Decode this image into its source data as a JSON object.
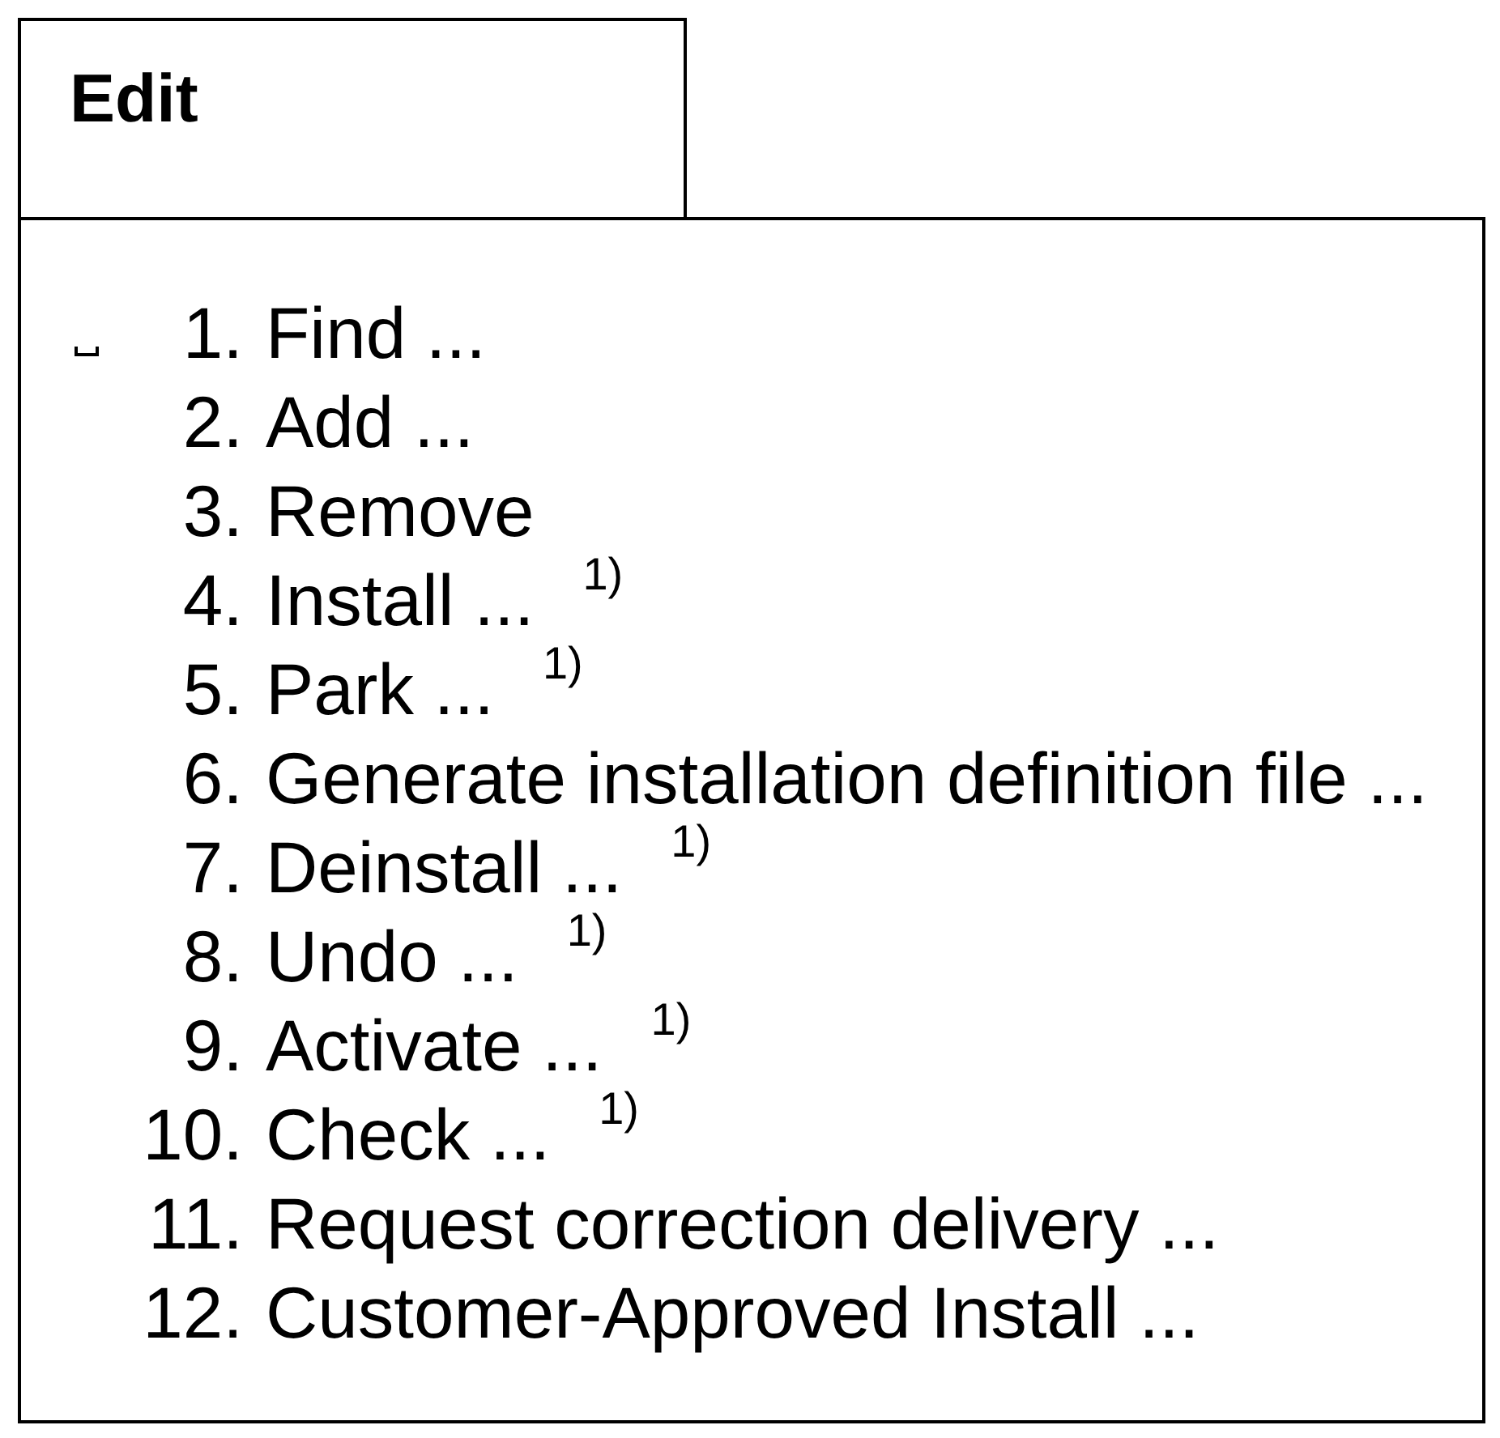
{
  "menu": {
    "title": "Edit",
    "items": [
      {
        "number": "1.",
        "label": "Find ...",
        "selected": true
      },
      {
        "number": "2.",
        "label": "Add ...",
        "selected": false
      },
      {
        "number": "3.",
        "label": "Remove",
        "selected": false
      },
      {
        "number": "4.",
        "label": "Install ...",
        "footnote": "1)",
        "selected": false
      },
      {
        "number": "5.",
        "label": "Park ...",
        "footnote": "1)",
        "selected": false
      },
      {
        "number": "6.",
        "label": "Generate installation definition file ...",
        "selected": false
      },
      {
        "number": "7.",
        "label": "Deinstall ...",
        "footnote": "1)",
        "selected": false
      },
      {
        "number": "8.",
        "label": "Undo ...",
        "footnote": "1)",
        "selected": false
      },
      {
        "number": "9.",
        "label": "Activate ...",
        "footnote": "1)",
        "selected": false
      },
      {
        "number": "10.",
        "label": "Check ...",
        "footnote": "1)",
        "selected": false
      },
      {
        "number": "11.",
        "label": "Request correction delivery ...",
        "selected": false
      },
      {
        "number": "12.",
        "label": "Customer-Approved Install ...",
        "selected": false
      }
    ]
  }
}
